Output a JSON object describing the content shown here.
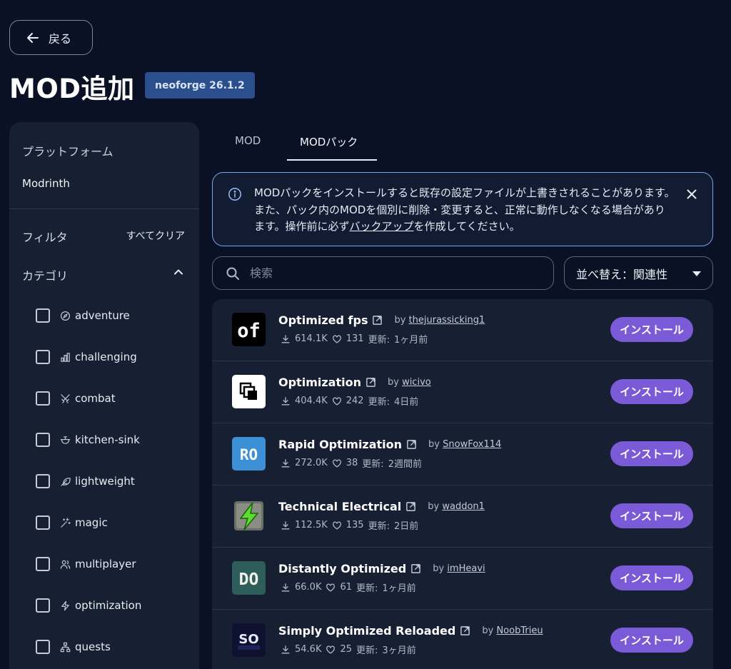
{
  "header": {
    "back_label": "戻る",
    "title": "MOD追加",
    "version_badge": "neoforge 26.1.2"
  },
  "sidebar": {
    "platform_heading": "プラットフォーム",
    "platform_value": "Modrinth",
    "filter_heading": "フィルタ",
    "clear_all": "すべてクリア",
    "category_heading": "カテゴリ",
    "categories": [
      {
        "label": "adventure",
        "icon": "compass-icon",
        "checked": false
      },
      {
        "label": "challenging",
        "icon": "bar-chart-icon",
        "checked": false
      },
      {
        "label": "combat",
        "icon": "crossed-swords-icon",
        "checked": false
      },
      {
        "label": "kitchen-sink",
        "icon": "bowl-icon",
        "checked": false
      },
      {
        "label": "lightweight",
        "icon": "feather-icon",
        "checked": false
      },
      {
        "label": "magic",
        "icon": "magic-wand-icon",
        "checked": false
      },
      {
        "label": "multiplayer",
        "icon": "users-icon",
        "checked": false
      },
      {
        "label": "optimization",
        "icon": "lightning-icon",
        "checked": false
      },
      {
        "label": "quests",
        "icon": "network-icon",
        "checked": false
      }
    ]
  },
  "tabs": [
    {
      "label": "MOD",
      "active": false
    },
    {
      "label": "MODパック",
      "active": true
    }
  ],
  "alert": {
    "text_before": "MODパックをインストールすると既存の設定ファイルが上書きされることがあります。また、パック内のMODを個別に削除・変更すると、正常に動作しなくなる場合があります。操作前に必ず",
    "link": "バックアップ",
    "text_after": "を作成してください。"
  },
  "search": {
    "placeholder": "検索",
    "value": ""
  },
  "sort": {
    "label": "並べ替え：関連性"
  },
  "results": {
    "by_label": "by",
    "updated_label": "更新:",
    "install_label": "インストール",
    "items": [
      {
        "name": "Optimized fps",
        "author": "thejurassicking1",
        "downloads": "614.1K",
        "likes": "131",
        "updated": "1ヶ月前",
        "icon": "of-logo"
      },
      {
        "name": "Optimization",
        "author": "wicivo",
        "downloads": "404.4K",
        "likes": "242",
        "updated": "4日前",
        "icon": "squares-logo"
      },
      {
        "name": "Rapid Optimization",
        "author": "SnowFox114",
        "downloads": "272.0K",
        "likes": "38",
        "updated": "2週間前",
        "icon": "ro-logo"
      },
      {
        "name": "Technical Electrical",
        "author": "waddon1",
        "downloads": "112.5K",
        "likes": "135",
        "updated": "2日前",
        "icon": "bolt-logo"
      },
      {
        "name": "Distantly Optimized",
        "author": "imHeavi",
        "downloads": "66.0K",
        "likes": "61",
        "updated": "1ヶ月前",
        "icon": "do-logo"
      },
      {
        "name": "Simply Optimized Reloaded",
        "author": "NoobTrieu",
        "downloads": "54.6K",
        "likes": "25",
        "updated": "3ヶ月前",
        "icon": "so-reloaded-logo"
      }
    ]
  }
}
